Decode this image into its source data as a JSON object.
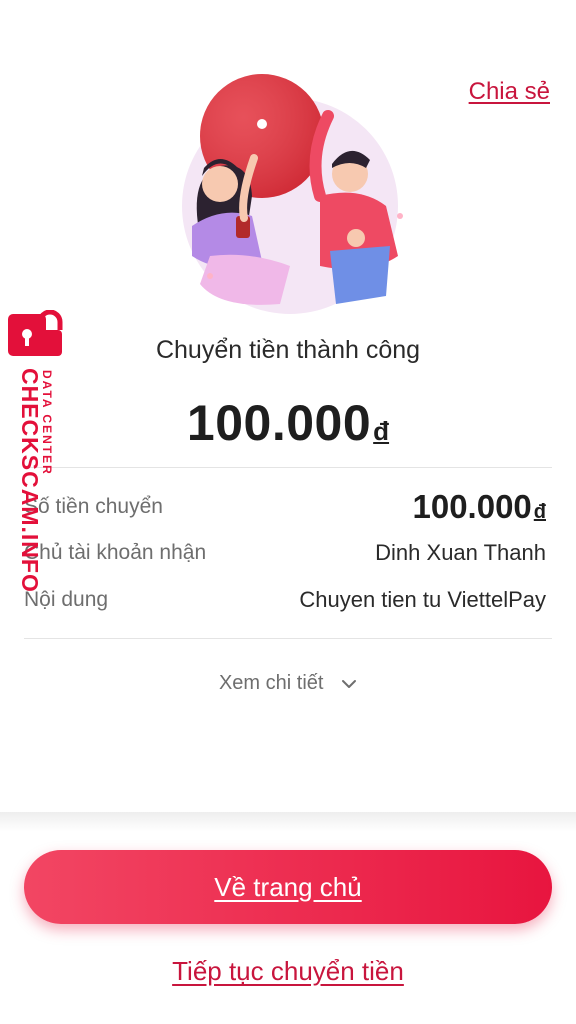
{
  "header": {
    "share_label": "Chia sẻ"
  },
  "result": {
    "title": "Chuyển tiền thành công",
    "amount": "100.000",
    "currency": "đ"
  },
  "details": {
    "rows": [
      {
        "label": "Số tiền chuyển",
        "value": "100.000",
        "currency": "đ"
      },
      {
        "label": "Chủ tài khoản nhận",
        "value": "Dinh Xuan Thanh"
      },
      {
        "label": "Nội dung",
        "value": "Chuyen tien tu ViettelPay"
      }
    ],
    "toggle_label": "Xem chi tiết",
    "toggle_icon": "chevron-down-icon"
  },
  "actions": {
    "home_label": "Về trang chủ",
    "continue_label": "Tiếp tục chuyển tiền"
  },
  "watermark": {
    "main": "CHECKSCAM.INFO",
    "sub": "DATA CENTER"
  },
  "colors": {
    "accent": "#e8153f",
    "link": "#c8153d"
  }
}
